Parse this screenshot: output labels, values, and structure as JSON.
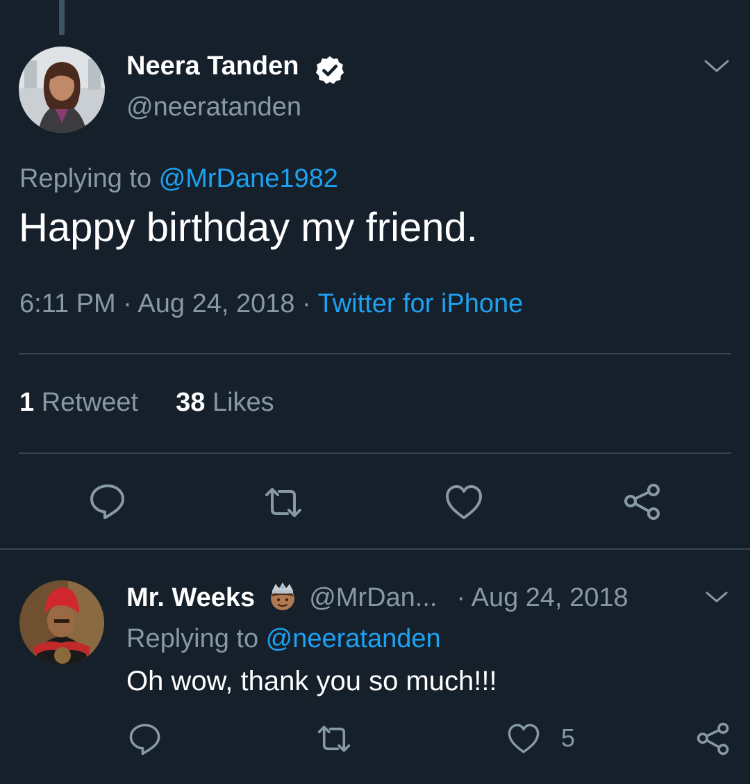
{
  "tweet": {
    "author_name": "Neera Tanden",
    "author_handle": "@neeratanden",
    "replying_prefix": "Replying to ",
    "replying_to": "@MrDane1982",
    "text": "Happy birthday my friend.",
    "time": "6:11 PM",
    "date": "Aug 24, 2018",
    "source": "Twitter for iPhone",
    "retweet_count": "1",
    "retweet_label": "Retweet",
    "like_count": "38",
    "like_label": "Likes"
  },
  "reply": {
    "author_name": "Mr. Weeks",
    "author_handle": "@MrDan...",
    "date": "Aug 24, 2018",
    "replying_prefix": "Replying to ",
    "replying_to": "@neeratanden",
    "text": "Oh wow, thank you so much!!!",
    "like_count": "5"
  },
  "icons": {
    "main_actions": [
      "reply-icon",
      "retweet-icon",
      "like-icon",
      "share-icon"
    ],
    "reply_actions": [
      "reply-icon",
      "retweet-icon",
      "like-icon",
      "share-icon"
    ],
    "chevron": "chevron-down-icon",
    "verified": "verified-badge-icon",
    "emoji": "prince-emoji-icon"
  },
  "colors": {
    "background": "#15202b",
    "text": "#ffffff",
    "secondary": "#8899a6",
    "link": "#1da1f2",
    "divider": "#38444d"
  }
}
